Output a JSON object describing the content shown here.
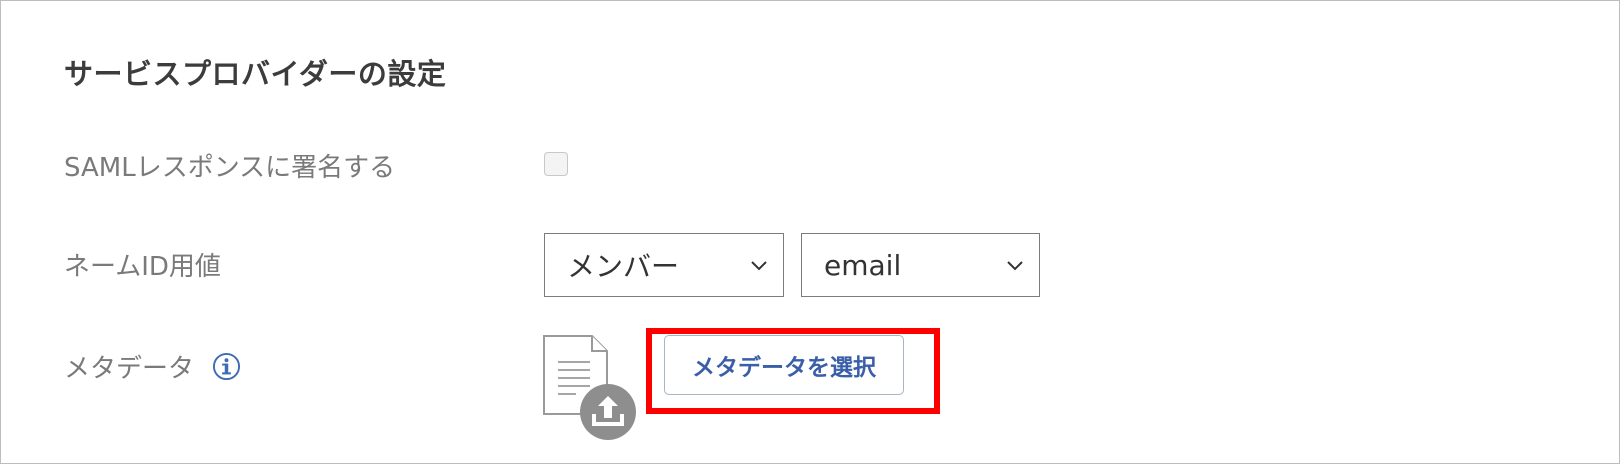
{
  "section": {
    "title": "サービスプロバイダーの設定"
  },
  "rows": {
    "saml_sign": {
      "label": "SAMLレスポンスに署名する",
      "checked": false
    },
    "name_id": {
      "label": "ネームID用値",
      "source_select": "メンバー",
      "attribute_select": "email"
    },
    "metadata": {
      "label": "メタデータ",
      "info_icon": "info-icon",
      "file_icon": "document-upload-icon",
      "button_label": "メタデータを選択"
    }
  },
  "colors": {
    "highlight": "#ff0000",
    "link_blue": "#3a5fa8",
    "info_blue": "#3d6bb5"
  }
}
